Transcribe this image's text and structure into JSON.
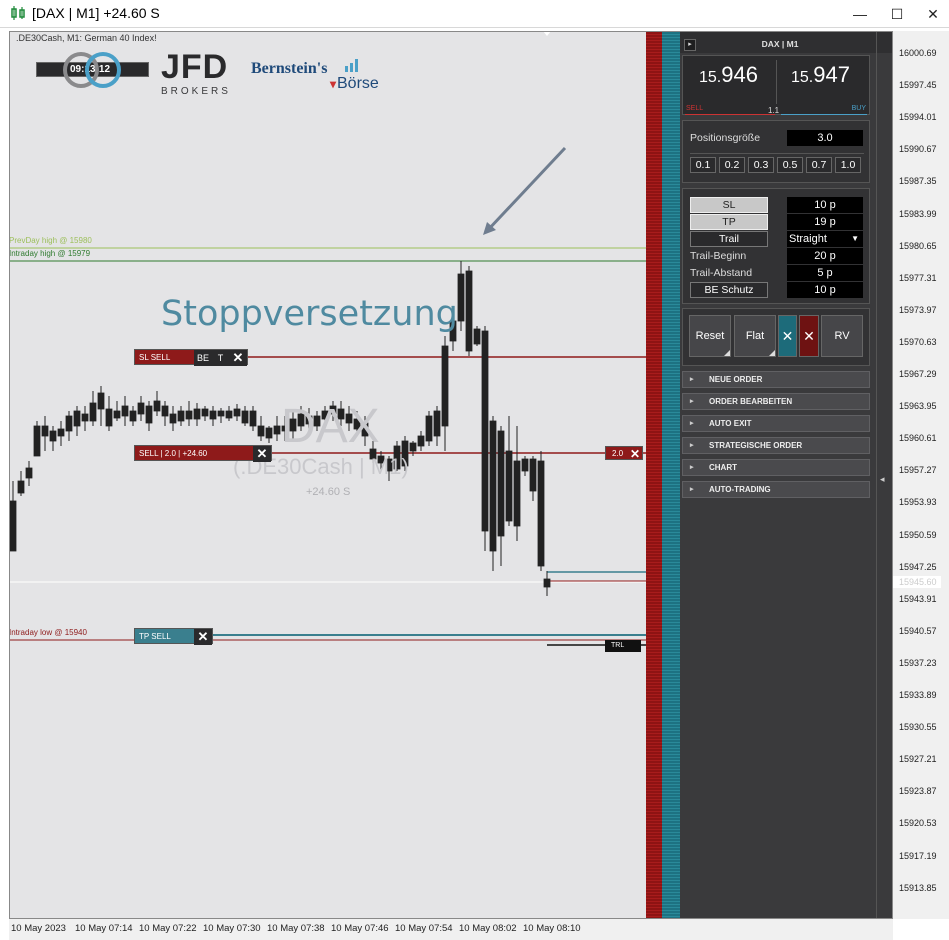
{
  "window": {
    "title": "[DAX | M1] +24.60 S",
    "minimize": "—",
    "maximize": "☐",
    "close": "✕"
  },
  "chart": {
    "info": ".DE30Cash, M1:  German 40 Index!",
    "timer": "09:13:12",
    "broker_logo_big": "JFD",
    "broker_logo_small": "BROKERS",
    "partner_logo_1": "Bernstein's",
    "partner_logo_2": "Börse",
    "annotation": "Stoppversetzung",
    "watermark_symbol": "DAX",
    "watermark_sub": "(.DE30Cash | M1)",
    "watermark_pl": "+24.60 S",
    "prev_day_high": "PrevDay high @ 15980",
    "intraday_high": "Intraday high @ 15979",
    "intraday_low": "Intraday low @ 15940",
    "current_price_label": "15945.60",
    "colors": {
      "sell": "#8e1a1a",
      "tp": "#3a7f8e",
      "bg": "#e4e4e6"
    }
  },
  "order_lines": {
    "sl_label": "SL SELL",
    "be_label": "BE",
    "t_label": "T",
    "sell_label": "SELL | 2.0 | +24.60",
    "tp_label": "TP SELL",
    "right_size_tag": "2.0",
    "trl_tag": "TRL",
    "close_glyph": "✕"
  },
  "price_scale": [
    "16000.69",
    "15997.45",
    "15994.01",
    "15990.67",
    "15987.35",
    "15983.99",
    "15980.65",
    "15977.31",
    "15973.97",
    "15970.63",
    "15967.29",
    "15963.95",
    "15960.61",
    "15957.27",
    "15953.93",
    "15950.59",
    "15947.25",
    "15943.91",
    "15940.57",
    "15937.23",
    "15933.89",
    "15930.55",
    "15927.21",
    "15923.87",
    "15920.53",
    "15917.19",
    "15913.85"
  ],
  "time_scale": [
    "10 May 2023",
    "10 May 07:14",
    "10 May 07:22",
    "10 May 07:30",
    "10 May 07:38",
    "10 May 07:46",
    "10 May 07:54",
    "10 May 08:02",
    "10 May 08:10"
  ],
  "panel": {
    "title": "DAX | M1",
    "collapse": "▸",
    "bid_small": "15.",
    "bid_big": "946",
    "ask_small": "15.",
    "ask_big": "947",
    "spread": "1.1",
    "sell_label": "SELL",
    "buy_label": "BUY",
    "position_label": "Positionsgröße",
    "position_value": "3.0",
    "quick_sizes": [
      "0.1",
      "0.2",
      "0.3",
      "0.5",
      "0.7",
      "1.0"
    ],
    "sl_label": "SL",
    "sl_value": "10 p",
    "tp_label": "TP",
    "tp_value": "19 p",
    "trail_label": "Trail",
    "trail_mode": "Straight",
    "trail_begin_label": "Trail-Beginn",
    "trail_begin_value": "20 p",
    "trail_distance_label": "Trail-Abstand",
    "trail_distance_value": "5 p",
    "be_label": "BE Schutz",
    "be_value": "10 p",
    "reset_label": "Reset",
    "flat_label": "Flat",
    "x_label": "✕",
    "rv_label": "RV",
    "sections": [
      "NEUE ORDER",
      "ORDER BEARBEITEN",
      "AUTO EXIT",
      "STRATEGISCHE ORDER",
      "CHART",
      "AUTO-TRADING"
    ],
    "section_arrow": "▸",
    "side_arrow": "◂"
  }
}
